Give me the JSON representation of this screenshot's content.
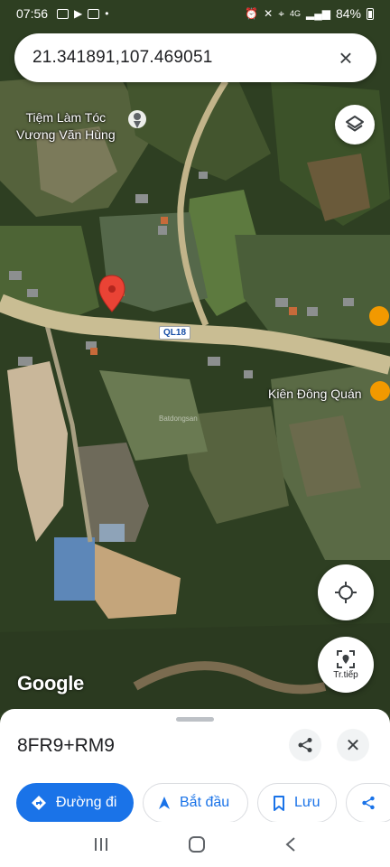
{
  "status_bar": {
    "time": "07:56",
    "signal": "4G",
    "battery": "84%"
  },
  "search": {
    "query": "21.341891,107.469051"
  },
  "map": {
    "poi_shop": [
      "Tiệm Làm Tóc",
      "Vương Văn Hùng"
    ],
    "road_shield": "QL18",
    "poi_restaurant": "Kiên Đông Quán",
    "google_logo": "Google",
    "watermark": "Batdongsan",
    "nav_button_label": "Tr.tiếp"
  },
  "sheet": {
    "plus_code": "8FR9+RM9",
    "actions": {
      "directions": "Đường đi",
      "start": "Bắt đầu",
      "save": "Lưu"
    }
  },
  "colors": {
    "accent": "#1a73e8",
    "pin": "#ea4335",
    "road": "#c9bd93"
  },
  "icons": [
    "search-icon",
    "close-icon",
    "layers-icon",
    "my-location-icon",
    "navigation-icon",
    "map-pin-icon",
    "restaurant-icon",
    "share-icon",
    "directions-icon",
    "start-icon",
    "bookmark-icon"
  ]
}
